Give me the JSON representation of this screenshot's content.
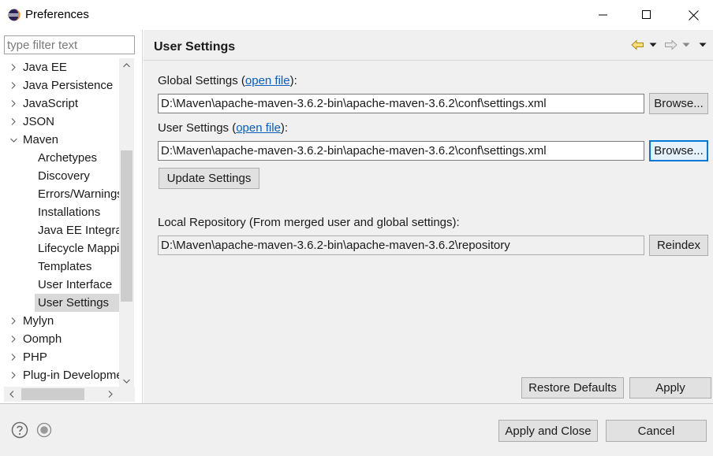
{
  "window": {
    "title": "Preferences"
  },
  "filter": {
    "placeholder": "type filter text"
  },
  "tree": {
    "items": [
      {
        "label": "Java EE",
        "expanded": false
      },
      {
        "label": "Java Persistence",
        "expanded": false
      },
      {
        "label": "JavaScript",
        "expanded": false
      },
      {
        "label": "JSON",
        "expanded": false
      },
      {
        "label": "Maven",
        "expanded": true
      },
      {
        "label": "Archetypes"
      },
      {
        "label": "Discovery"
      },
      {
        "label": "Errors/Warnings"
      },
      {
        "label": "Installations"
      },
      {
        "label": "Java EE Integration"
      },
      {
        "label": "Lifecycle Mappings"
      },
      {
        "label": "Templates"
      },
      {
        "label": "User Interface"
      },
      {
        "label": "User Settings",
        "selected": true
      },
      {
        "label": "Mylyn",
        "expanded": false
      },
      {
        "label": "Oomph",
        "expanded": false
      },
      {
        "label": "PHP",
        "expanded": false
      },
      {
        "label": "Plug-in Development",
        "expanded": false
      }
    ]
  },
  "page": {
    "title": "User Settings",
    "global_settings": {
      "label_prefix": "Global Settings (",
      "link": "open file",
      "label_suffix": "):",
      "path": "D:\\Maven\\apache-maven-3.6.2-bin\\apache-maven-3.6.2\\conf\\settings.xml",
      "browse": "Browse..."
    },
    "user_settings": {
      "label_prefix": "User Settings (",
      "link": "open file",
      "label_suffix": "):",
      "path": "D:\\Maven\\apache-maven-3.6.2-bin\\apache-maven-3.6.2\\conf\\settings.xml",
      "browse": "Browse..."
    },
    "update_settings": "Update Settings",
    "local_repository": {
      "label": "Local Repository (From merged user and global settings):",
      "path": "D:\\Maven\\apache-maven-3.6.2-bin\\apache-maven-3.6.2\\repository",
      "reindex": "Reindex"
    },
    "restore_defaults": "Restore Defaults",
    "apply": "Apply"
  },
  "footer": {
    "apply_and_close": "Apply and Close",
    "cancel": "Cancel"
  },
  "colors": {
    "accent": "#0078d7",
    "link": "#0a5dbf",
    "panel_bg": "#f0f0f0"
  }
}
